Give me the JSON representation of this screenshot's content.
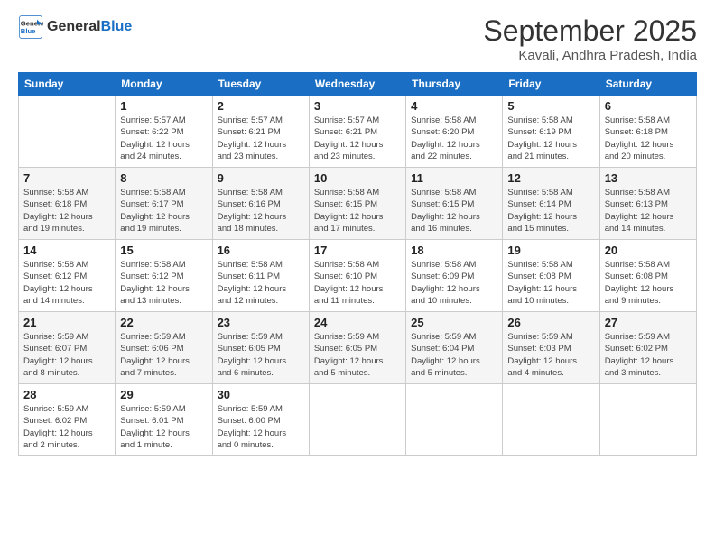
{
  "logo": {
    "line1": "General",
    "line2": "Blue"
  },
  "title": "September 2025",
  "location": "Kavali, Andhra Pradesh, India",
  "days_header": [
    "Sunday",
    "Monday",
    "Tuesday",
    "Wednesday",
    "Thursday",
    "Friday",
    "Saturday"
  ],
  "weeks": [
    [
      {
        "num": "",
        "info": ""
      },
      {
        "num": "1",
        "info": "Sunrise: 5:57 AM\nSunset: 6:22 PM\nDaylight: 12 hours\nand 24 minutes."
      },
      {
        "num": "2",
        "info": "Sunrise: 5:57 AM\nSunset: 6:21 PM\nDaylight: 12 hours\nand 23 minutes."
      },
      {
        "num": "3",
        "info": "Sunrise: 5:57 AM\nSunset: 6:21 PM\nDaylight: 12 hours\nand 23 minutes."
      },
      {
        "num": "4",
        "info": "Sunrise: 5:58 AM\nSunset: 6:20 PM\nDaylight: 12 hours\nand 22 minutes."
      },
      {
        "num": "5",
        "info": "Sunrise: 5:58 AM\nSunset: 6:19 PM\nDaylight: 12 hours\nand 21 minutes."
      },
      {
        "num": "6",
        "info": "Sunrise: 5:58 AM\nSunset: 6:18 PM\nDaylight: 12 hours\nand 20 minutes."
      }
    ],
    [
      {
        "num": "7",
        "info": "Sunrise: 5:58 AM\nSunset: 6:18 PM\nDaylight: 12 hours\nand 19 minutes."
      },
      {
        "num": "8",
        "info": "Sunrise: 5:58 AM\nSunset: 6:17 PM\nDaylight: 12 hours\nand 19 minutes."
      },
      {
        "num": "9",
        "info": "Sunrise: 5:58 AM\nSunset: 6:16 PM\nDaylight: 12 hours\nand 18 minutes."
      },
      {
        "num": "10",
        "info": "Sunrise: 5:58 AM\nSunset: 6:15 PM\nDaylight: 12 hours\nand 17 minutes."
      },
      {
        "num": "11",
        "info": "Sunrise: 5:58 AM\nSunset: 6:15 PM\nDaylight: 12 hours\nand 16 minutes."
      },
      {
        "num": "12",
        "info": "Sunrise: 5:58 AM\nSunset: 6:14 PM\nDaylight: 12 hours\nand 15 minutes."
      },
      {
        "num": "13",
        "info": "Sunrise: 5:58 AM\nSunset: 6:13 PM\nDaylight: 12 hours\nand 14 minutes."
      }
    ],
    [
      {
        "num": "14",
        "info": "Sunrise: 5:58 AM\nSunset: 6:12 PM\nDaylight: 12 hours\nand 14 minutes."
      },
      {
        "num": "15",
        "info": "Sunrise: 5:58 AM\nSunset: 6:12 PM\nDaylight: 12 hours\nand 13 minutes."
      },
      {
        "num": "16",
        "info": "Sunrise: 5:58 AM\nSunset: 6:11 PM\nDaylight: 12 hours\nand 12 minutes."
      },
      {
        "num": "17",
        "info": "Sunrise: 5:58 AM\nSunset: 6:10 PM\nDaylight: 12 hours\nand 11 minutes."
      },
      {
        "num": "18",
        "info": "Sunrise: 5:58 AM\nSunset: 6:09 PM\nDaylight: 12 hours\nand 10 minutes."
      },
      {
        "num": "19",
        "info": "Sunrise: 5:58 AM\nSunset: 6:08 PM\nDaylight: 12 hours\nand 10 minutes."
      },
      {
        "num": "20",
        "info": "Sunrise: 5:58 AM\nSunset: 6:08 PM\nDaylight: 12 hours\nand 9 minutes."
      }
    ],
    [
      {
        "num": "21",
        "info": "Sunrise: 5:59 AM\nSunset: 6:07 PM\nDaylight: 12 hours\nand 8 minutes."
      },
      {
        "num": "22",
        "info": "Sunrise: 5:59 AM\nSunset: 6:06 PM\nDaylight: 12 hours\nand 7 minutes."
      },
      {
        "num": "23",
        "info": "Sunrise: 5:59 AM\nSunset: 6:05 PM\nDaylight: 12 hours\nand 6 minutes."
      },
      {
        "num": "24",
        "info": "Sunrise: 5:59 AM\nSunset: 6:05 PM\nDaylight: 12 hours\nand 5 minutes."
      },
      {
        "num": "25",
        "info": "Sunrise: 5:59 AM\nSunset: 6:04 PM\nDaylight: 12 hours\nand 5 minutes."
      },
      {
        "num": "26",
        "info": "Sunrise: 5:59 AM\nSunset: 6:03 PM\nDaylight: 12 hours\nand 4 minutes."
      },
      {
        "num": "27",
        "info": "Sunrise: 5:59 AM\nSunset: 6:02 PM\nDaylight: 12 hours\nand 3 minutes."
      }
    ],
    [
      {
        "num": "28",
        "info": "Sunrise: 5:59 AM\nSunset: 6:02 PM\nDaylight: 12 hours\nand 2 minutes."
      },
      {
        "num": "29",
        "info": "Sunrise: 5:59 AM\nSunset: 6:01 PM\nDaylight: 12 hours\nand 1 minute."
      },
      {
        "num": "30",
        "info": "Sunrise: 5:59 AM\nSunset: 6:00 PM\nDaylight: 12 hours\nand 0 minutes."
      },
      {
        "num": "",
        "info": ""
      },
      {
        "num": "",
        "info": ""
      },
      {
        "num": "",
        "info": ""
      },
      {
        "num": "",
        "info": ""
      }
    ]
  ]
}
